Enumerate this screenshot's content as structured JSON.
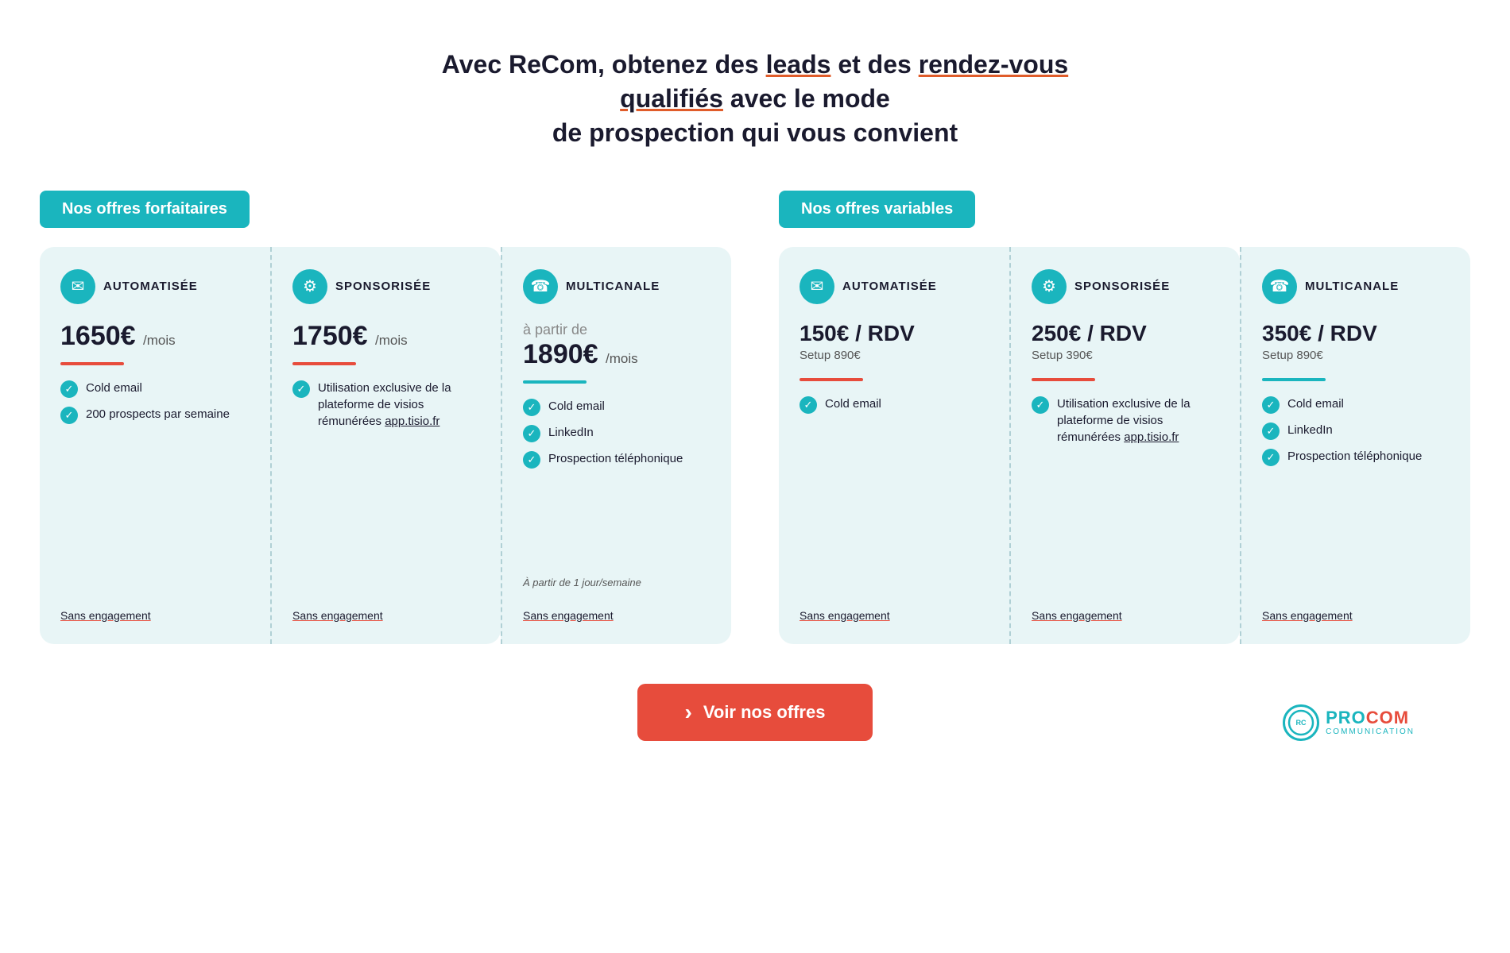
{
  "header": {
    "title_part1": "Avec ReCom, obtenez des ",
    "title_link1": "leads",
    "title_part2": " et des ",
    "title_link2": "rendez-vous qualifiés",
    "title_part3": " avec le mode",
    "title_line2": "de prospection qui vous convient"
  },
  "sections": {
    "forfaitaires": {
      "label": "Nos offres forfaitaires"
    },
    "variables": {
      "label": "Nos offres variables"
    }
  },
  "cards_forfaitaires": [
    {
      "icon": "✉",
      "title": "AUTOMATISÉE",
      "price": "1650€",
      "price_unit": "/mois",
      "divider": "red",
      "features": [
        "Cold email",
        "200 prospects par semaine"
      ],
      "italic_note": "",
      "sans_engagement": "Sans engagement"
    },
    {
      "icon": "⚙",
      "title": "SPONSORISÉE",
      "price": "1750€",
      "price_unit": "/mois",
      "divider": "red",
      "features": [
        "Utilisation exclusive de la plateforme de visios rémunérées app.tisio.fr"
      ],
      "italic_note": "",
      "sans_engagement": "Sans engagement"
    },
    {
      "icon": "☎",
      "title": "MULTICANALE",
      "price_label": "à partir de",
      "price": "1890€",
      "price_unit": "/mois",
      "divider": "teal",
      "features": [
        "Cold email",
        "LinkedIn",
        "Prospection téléphonique"
      ],
      "italic_note": "À partir de 1 jour/semaine",
      "sans_engagement": "Sans engagement"
    }
  ],
  "cards_variables": [
    {
      "icon": "✉",
      "title": "AUTOMATISÉE",
      "price": "150€ / RDV",
      "price_sub": "Setup 890€",
      "divider": "red",
      "features": [
        "Cold email"
      ],
      "italic_note": "",
      "sans_engagement": "Sans engagement"
    },
    {
      "icon": "⚙",
      "title": "SPONSORISÉE",
      "price": "250€ / RDV",
      "price_sub": "Setup 390€",
      "divider": "red",
      "features": [
        "Utilisation exclusive de la plateforme de visios rémunérées app.tisio.fr"
      ],
      "italic_note": "",
      "sans_engagement": "Sans engagement"
    },
    {
      "icon": "☎",
      "title": "MULTICANALE",
      "price": "350€ / RDV",
      "price_sub": "Setup 890€",
      "divider": "teal",
      "features": [
        "Cold email",
        "LinkedIn",
        "Prospection téléphonique"
      ],
      "italic_note": "",
      "sans_engagement": "Sans engagement"
    }
  ],
  "cta": {
    "label": "Voir nos offres"
  },
  "logo": {
    "text1": "PRO",
    "text2": "COM",
    "subtitle": "COMMUNICATION"
  }
}
